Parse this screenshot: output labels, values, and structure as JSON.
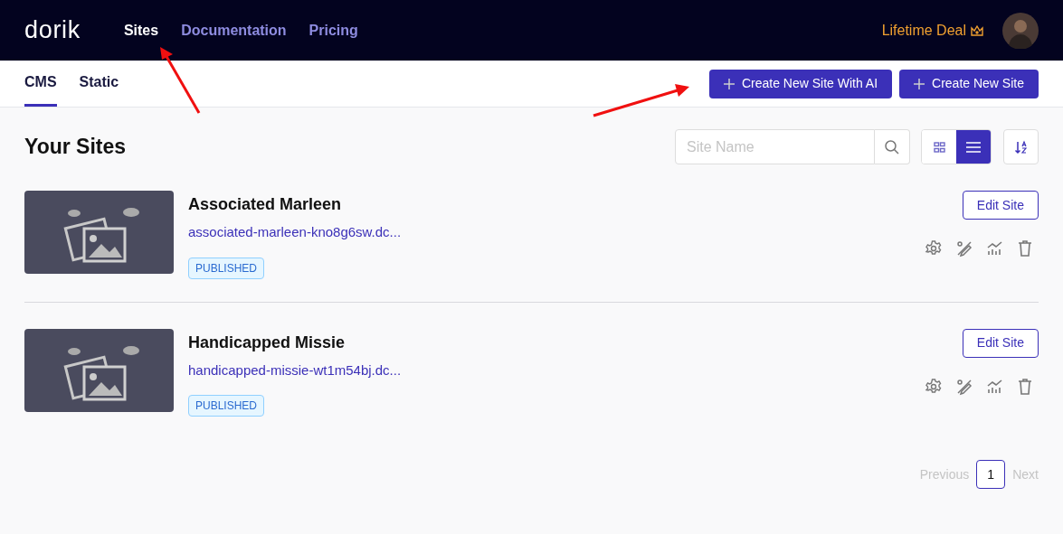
{
  "header": {
    "logo": "dorik",
    "nav": [
      {
        "label": "Sites",
        "selected": true
      },
      {
        "label": "Documentation",
        "selected": false
      },
      {
        "label": "Pricing",
        "selected": false
      }
    ],
    "deal": "Lifetime Deal"
  },
  "subnav": {
    "tabs": [
      {
        "label": "CMS",
        "selected": true
      },
      {
        "label": "Static",
        "selected": false
      }
    ],
    "buttons": [
      "Create New Site With AI",
      "Create New Site"
    ]
  },
  "heading": "Your Sites",
  "search": {
    "placeholder": "Site Name"
  },
  "view_toggle": [
    {
      "kind": "grid",
      "selected": false
    },
    {
      "kind": "list",
      "selected": true
    }
  ],
  "sites": [
    {
      "name": "Associated Marleen",
      "url": "associated-marleen-kno8g6sw.dc...",
      "status": "PUBLISHED",
      "edit": "Edit Site"
    },
    {
      "name": "Handicapped Missie",
      "url": "handicapped-missie-wt1m54bj.dc...",
      "status": "PUBLISHED",
      "edit": "Edit Site"
    }
  ],
  "pagination": {
    "previous": "Previous",
    "pages": [
      {
        "label": "1",
        "selected": true
      }
    ],
    "next": "Next"
  }
}
